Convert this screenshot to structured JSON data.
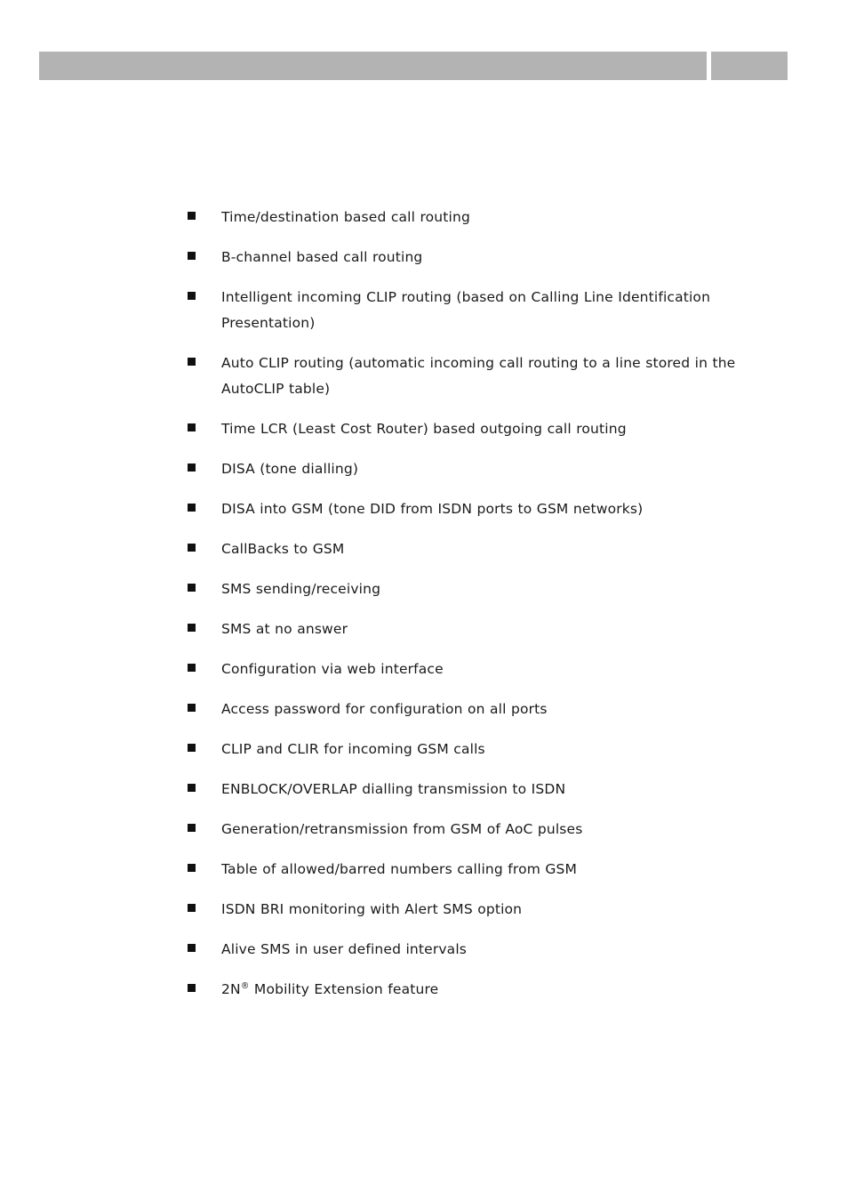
{
  "document": {
    "background_color": "#ffffff",
    "text_color": "#1a1a1a"
  },
  "header": {
    "band_color": "#b3b3b3",
    "title": "",
    "segments": [
      "main-band",
      "accent-band"
    ]
  },
  "features": {
    "bullet_glyph": "filled-square",
    "bullet_color": "#101010",
    "items": [
      {
        "text": "Time/destination based call routing"
      },
      {
        "text": "B-channel based call routing"
      },
      {
        "text": "Intelligent incoming CLIP routing (based on Calling Line Identification Presentation)"
      },
      {
        "text": "Auto CLIP routing (automatic incoming call routing to a line stored in the AutoCLIP table)"
      },
      {
        "text": "Time LCR (Least Cost Router) based outgoing call routing"
      },
      {
        "text": "DISA (tone dialling)"
      },
      {
        "text": "DISA into GSM (tone DID from ISDN ports to GSM networks)"
      },
      {
        "text": "CallBacks to GSM"
      },
      {
        "text": "SMS sending/receiving"
      },
      {
        "text": "SMS at no answer"
      },
      {
        "text": "Configuration via web interface"
      },
      {
        "text": "Access password for configuration on all ports"
      },
      {
        "text": "CLIP and CLIR for incoming GSM calls"
      },
      {
        "text": "ENBLOCK/OVERLAP dialling transmission to ISDN"
      },
      {
        "text": "Generation/retransmission from GSM of AoC pulses"
      },
      {
        "text": "Table of allowed/barred numbers calling from GSM"
      },
      {
        "text": "ISDN BRI monitoring with Alert SMS option"
      },
      {
        "text": "Alive SMS in user defined intervals"
      },
      {
        "text_prefix": "2N",
        "superscript": "®",
        "text_suffix": " Mobility Extension feature"
      }
    ]
  }
}
